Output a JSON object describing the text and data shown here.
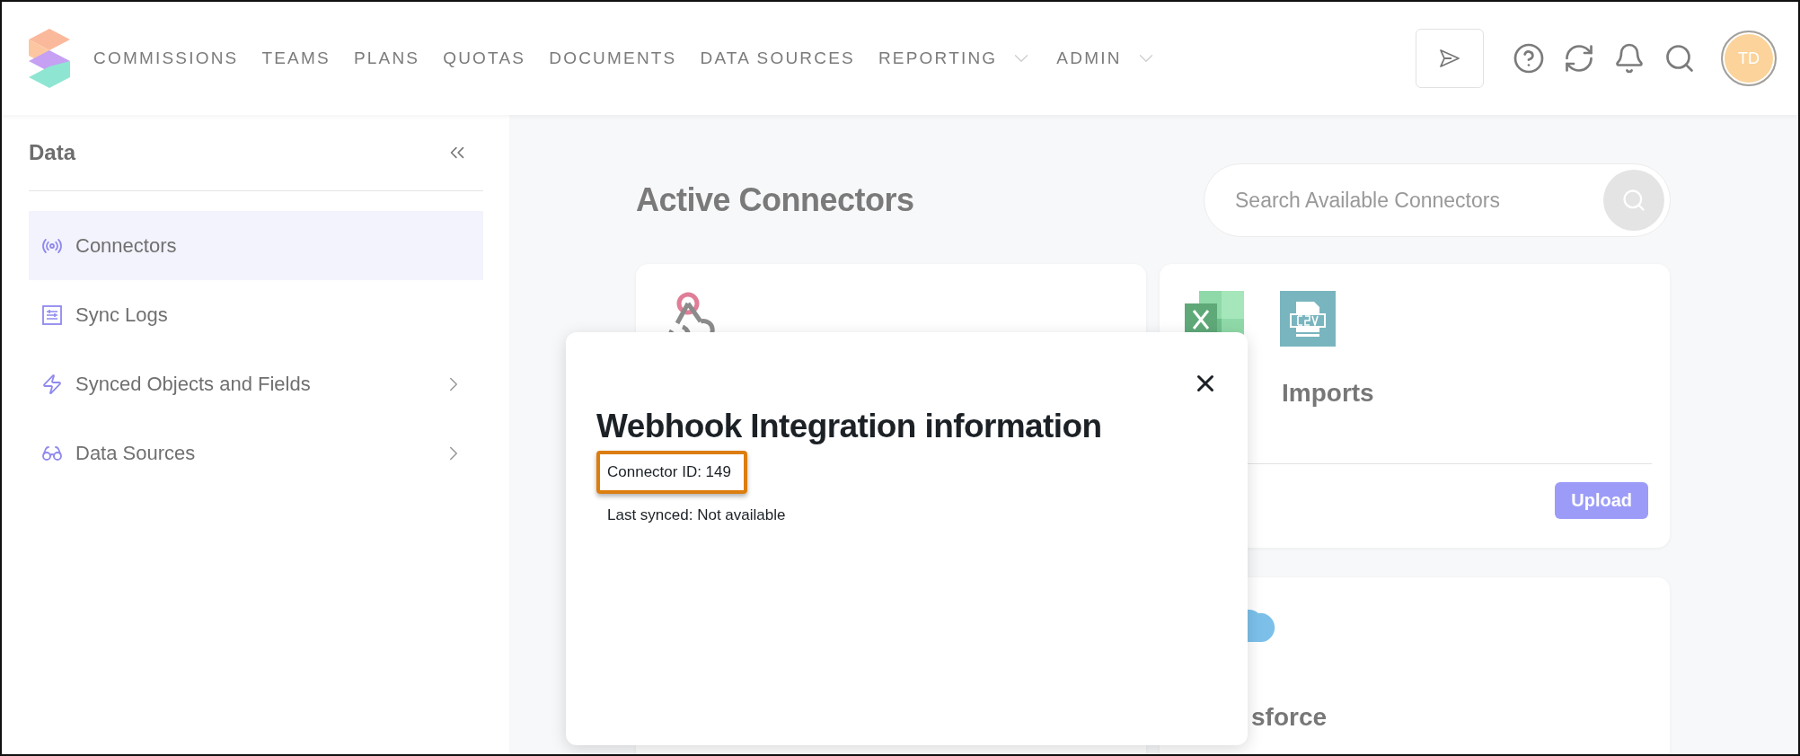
{
  "nav": {
    "items": [
      {
        "label": "COMMISSIONS",
        "has_menu": false
      },
      {
        "label": "TEAMS",
        "has_menu": false
      },
      {
        "label": "PLANS",
        "has_menu": false
      },
      {
        "label": "QUOTAS",
        "has_menu": false
      },
      {
        "label": "DOCUMENTS",
        "has_menu": false
      },
      {
        "label": "DATA SOURCES",
        "has_menu": false
      },
      {
        "label": "REPORTING",
        "has_menu": true
      },
      {
        "label": "ADMIN",
        "has_menu": true
      }
    ]
  },
  "user": {
    "initials": "TD"
  },
  "sidebar": {
    "title": "Data",
    "items": [
      {
        "label": "Connectors",
        "kind": "connectors",
        "selected": true,
        "expandable": false
      },
      {
        "label": "Sync Logs",
        "kind": "logs",
        "selected": false,
        "expandable": false
      },
      {
        "label": "Synced Objects and Fields",
        "kind": "objects",
        "selected": false,
        "expandable": true
      },
      {
        "label": "Data Sources",
        "kind": "sources",
        "selected": false,
        "expandable": true
      }
    ]
  },
  "main": {
    "title": "Active Connectors",
    "search": {
      "placeholder": "Search Available Connectors"
    },
    "cards": [
      {
        "kind": "webhook"
      },
      {
        "kind": "imports",
        "title": "Imports",
        "button": "Upload"
      },
      {
        "kind": "blank"
      },
      {
        "kind": "salesforce",
        "title": "sforce"
      }
    ]
  },
  "modal": {
    "title": "Webhook Integration information",
    "lines": [
      {
        "text": "Connector ID: 149",
        "highlighted": true
      },
      {
        "text": "Last synced: Not available",
        "highlighted": false
      }
    ]
  }
}
